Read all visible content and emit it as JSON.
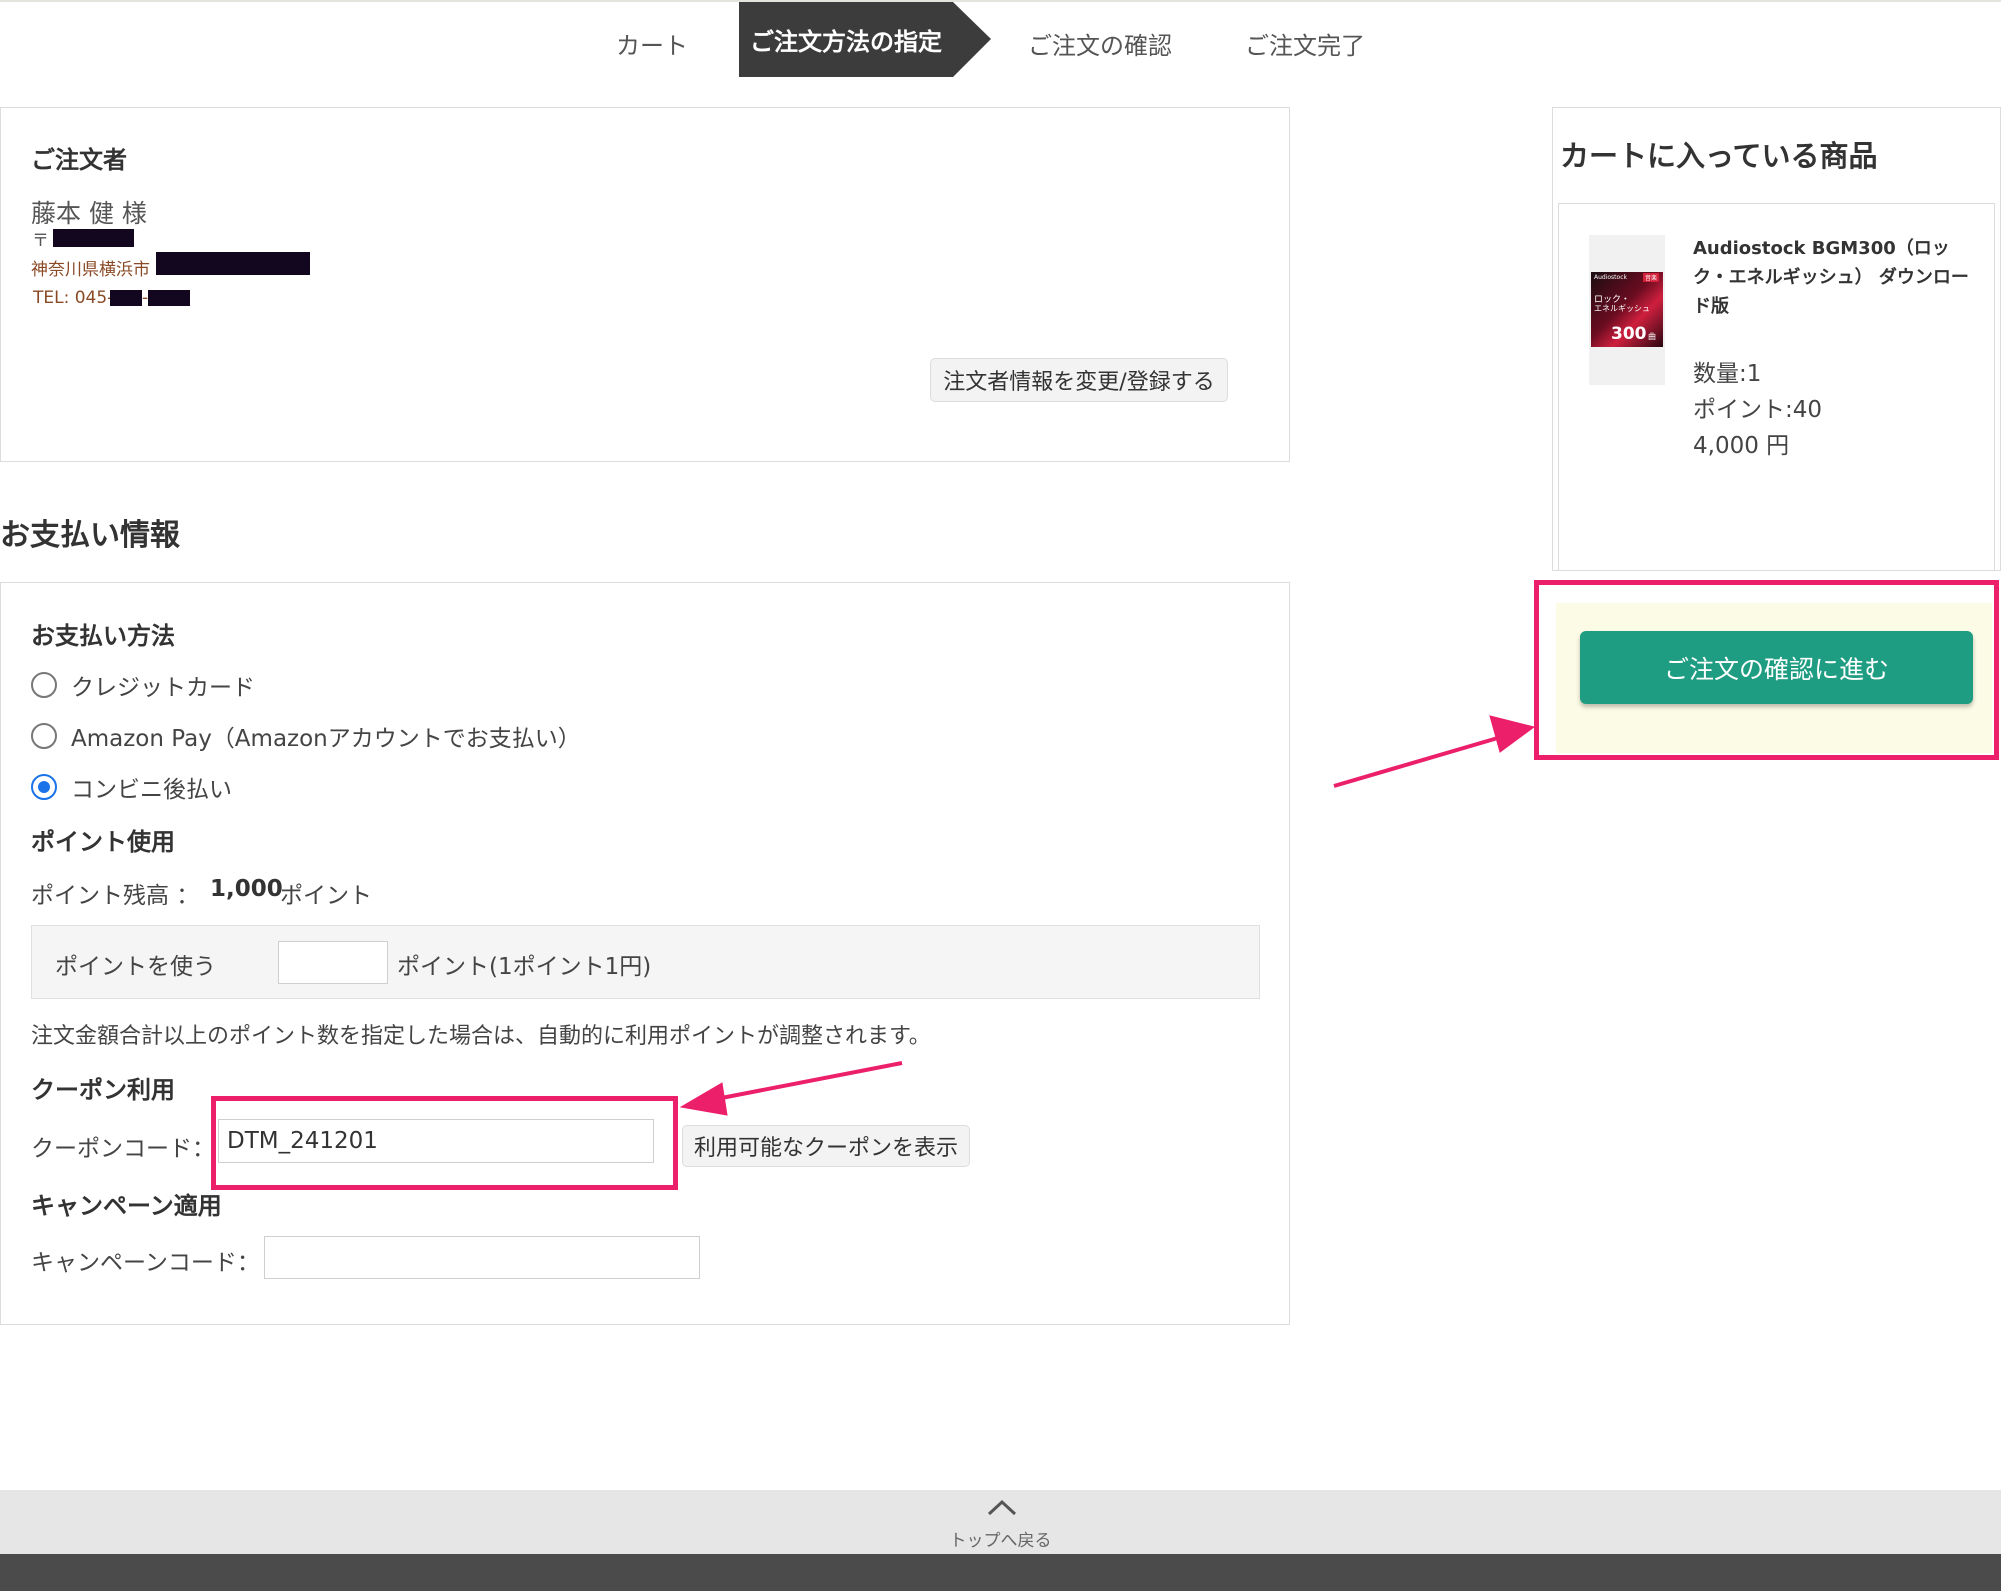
{
  "steps": {
    "cart": "カート",
    "specify": "ご注文方法の指定",
    "confirm": "ご注文の確認",
    "complete": "ご注文完了"
  },
  "orderer": {
    "heading": "ご注文者",
    "name": "藤本 健 様",
    "postal_prefix": "〒",
    "address_prefix": "神奈川県横浜市",
    "tel_prefix": "TEL: 045-",
    "tel_dash": "-",
    "change_button": "注文者情報を変更/登録する"
  },
  "payment": {
    "section_title": "お支払い情報",
    "method_heading": "お支払い方法",
    "methods": [
      "クレジットカード",
      "Amazon Pay（Amazonアカウントでお支払い）",
      "コンビニ後払い"
    ],
    "selected_method": "コンビニ後払い",
    "points_heading": "ポイント使用",
    "points_balance_label": "ポイント残高 ：",
    "points_balance_value": "1,000",
    "points_unit": "ポイント",
    "use_points_label": "ポイントを使う",
    "use_points_value": "",
    "points_rate": "ポイント(1ポイント1円)",
    "points_note": "注文金額合計以上のポイント数を指定した場合は、自動的に利用ポイントが調整されます。",
    "coupon_heading": "クーポン利用",
    "coupon_label": "クーポンコード：",
    "coupon_value": "DTM_241201",
    "coupon_button": "利用可能なクーポンを表示",
    "campaign_heading": "キャンペーン適用",
    "campaign_label": "キャンペーンコード：",
    "campaign_value": ""
  },
  "cart": {
    "heading": "カートに入っている商品",
    "product_name": "Audiostock BGM300（ロック・エネルギッシュ） ダウンロード版",
    "quantity": "数量:1",
    "points": "ポイント:40",
    "price": "4,000 円",
    "thumb": {
      "brand": "Audiostock",
      "tag": "音楽",
      "line1": "ロック・",
      "line2": "エネルギッシュ",
      "count": "300",
      "count_unit": "曲"
    }
  },
  "proceed_button": "ご注文の確認に進む",
  "footer": {
    "back_to_top": "トップへ戻る"
  },
  "colors": {
    "accent_green": "#1f9d82",
    "highlight_pink": "#ec1f6b",
    "step_active_bg": "#3c3c3c",
    "cta_area_bg": "#fbfbe6"
  }
}
